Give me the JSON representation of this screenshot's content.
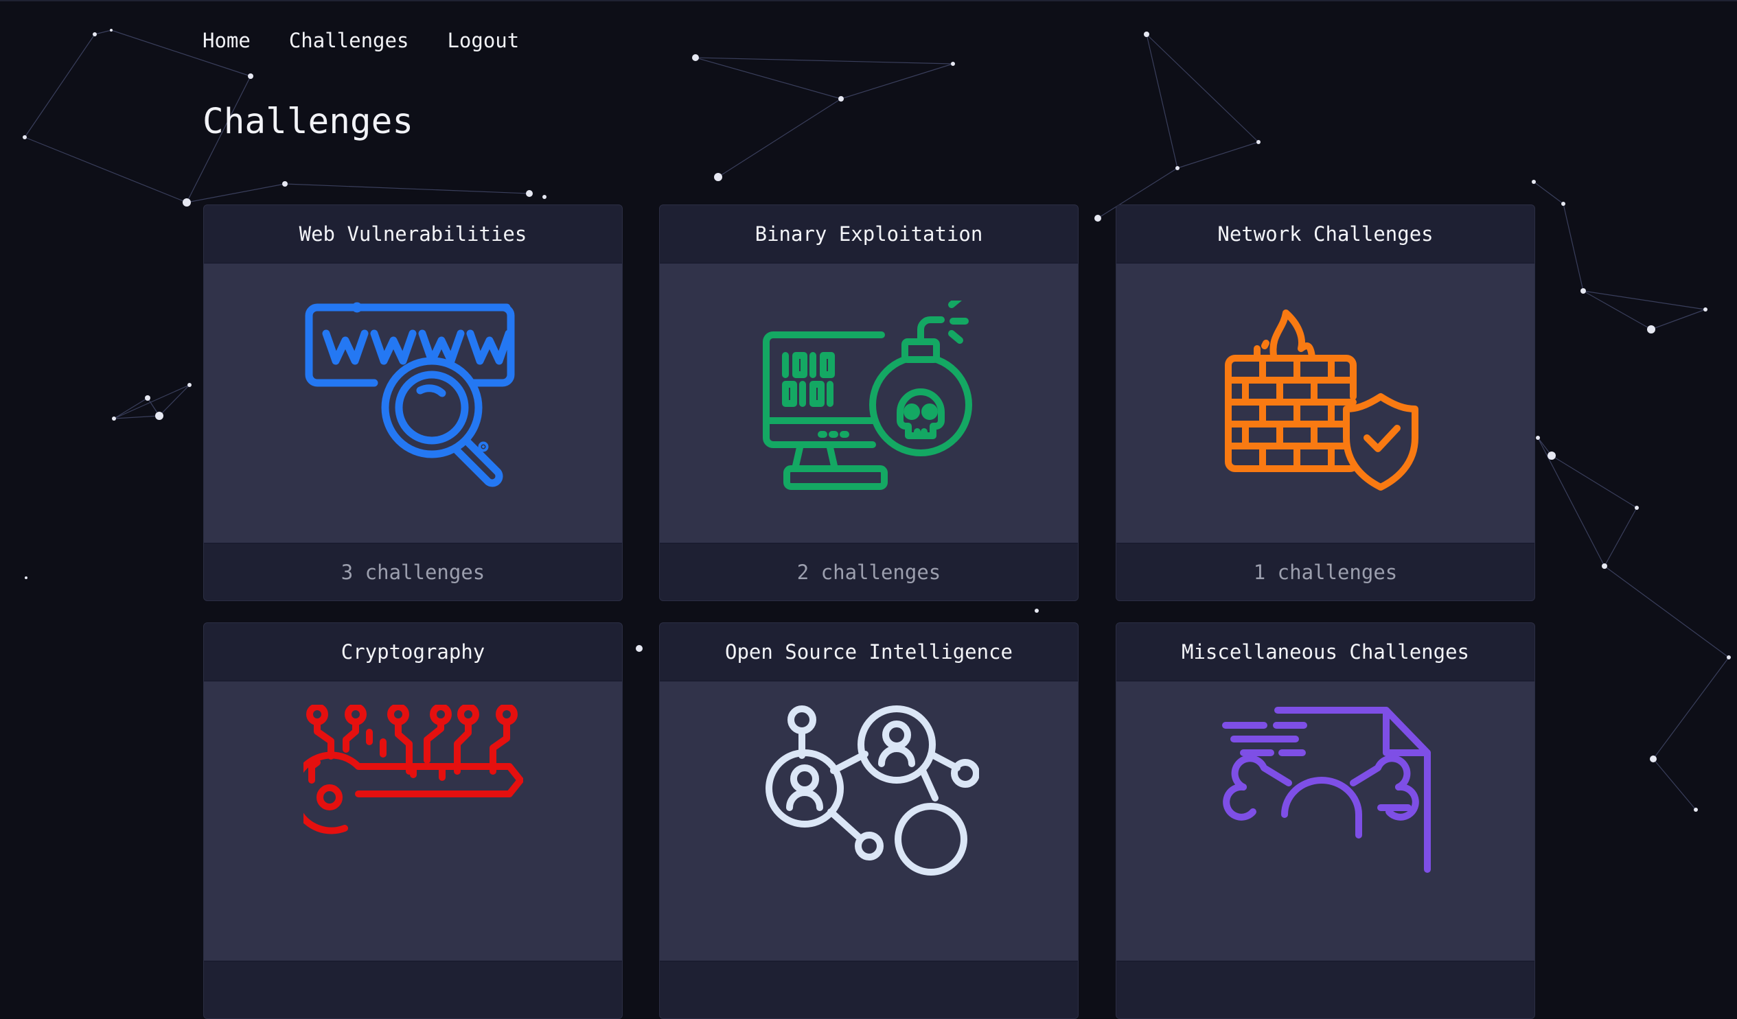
{
  "nav": {
    "home": "Home",
    "challenges": "Challenges",
    "logout": "Logout"
  },
  "page_title": "Challenges",
  "categories": [
    {
      "title": "Web Vulnerabilities",
      "count": "3 challenges",
      "icon": "www-search-icon",
      "color": "#2478f3"
    },
    {
      "title": "Binary Exploitation",
      "count": "2 challenges",
      "icon": "computer-bomb-icon",
      "color": "#14a863"
    },
    {
      "title": "Network Challenges",
      "count": "1 challenges",
      "icon": "firewall-icon",
      "color": "#f97a12"
    },
    {
      "title": "Cryptography",
      "count": "",
      "icon": "circuit-key-icon",
      "color": "#e5100f"
    },
    {
      "title": "Open Source Intelligence",
      "count": "",
      "icon": "people-network-icon",
      "color": "#dbe6f6"
    },
    {
      "title": "Miscellaneous Challenges",
      "count": "",
      "icon": "skull-document-icon",
      "color": "#7e4fe6"
    }
  ]
}
